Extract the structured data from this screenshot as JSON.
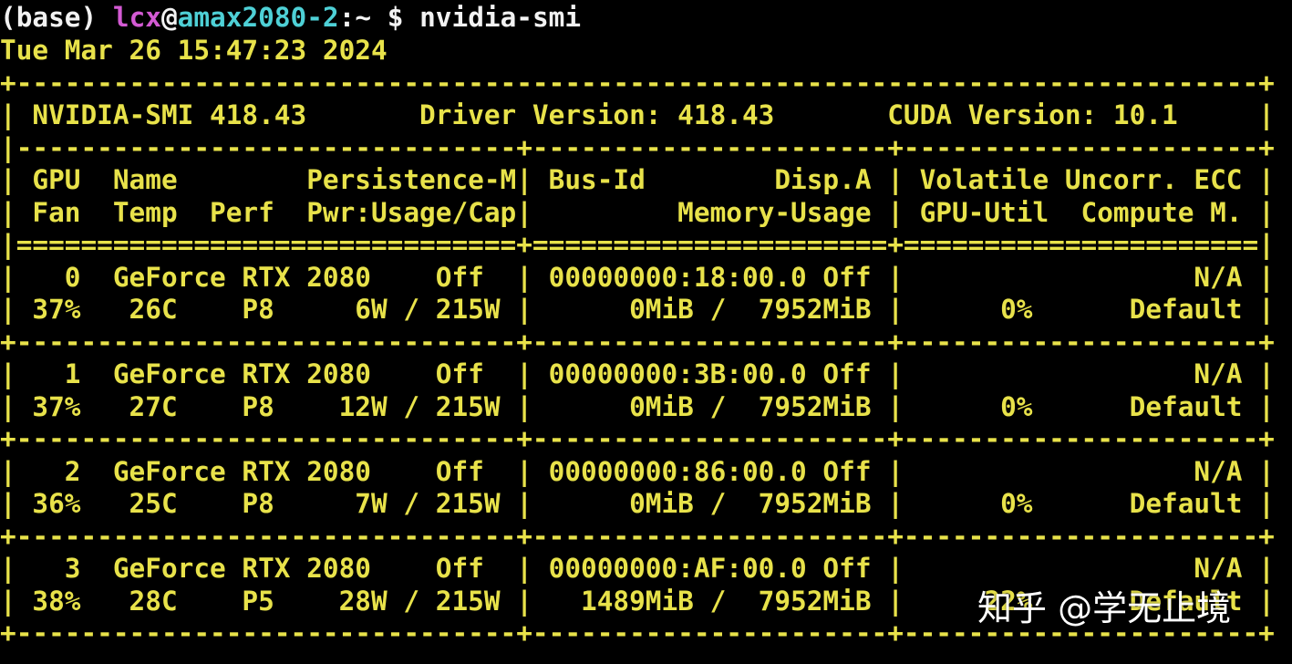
{
  "terminal": {
    "prompt": {
      "env": "(base) ",
      "user": "lcx",
      "at": "@",
      "host": "amax2080-2",
      "path_sep": ":~ $ ",
      "command": "nvidia-smi"
    },
    "timestamp": "Tue Mar 26 15:47:23 2024",
    "lines": [
      "+-----------------------------------------------------------------------------+",
      "| NVIDIA-SMI 418.43       Driver Version: 418.43       CUDA Version: 10.1     |",
      "|-------------------------------+----------------------+----------------------+",
      "| GPU  Name        Persistence-M| Bus-Id        Disp.A | Volatile Uncorr. ECC |",
      "| Fan  Temp  Perf  Pwr:Usage/Cap|         Memory-Usage | GPU-Util  Compute M. |",
      "|===============================+======================+======================|",
      "|   0  GeForce RTX 2080    Off  | 00000000:18:00.0 Off |                  N/A |",
      "| 37%   26C    P8     6W / 215W |      0MiB /  7952MiB |      0%      Default |",
      "+-------------------------------+----------------------+----------------------+",
      "|   1  GeForce RTX 2080    Off  | 00000000:3B:00.0 Off |                  N/A |",
      "| 37%   27C    P8    12W / 215W |      0MiB /  7952MiB |      0%      Default |",
      "+-------------------------------+----------------------+----------------------+",
      "|   2  GeForce RTX 2080    Off  | 00000000:86:00.0 Off |                  N/A |",
      "| 36%   25C    P8     7W / 215W |      0MiB /  7952MiB |      0%      Default |",
      "+-------------------------------+----------------------+----------------------+",
      "|   3  GeForce RTX 2080    Off  | 00000000:AF:00.0 Off |                  N/A |",
      "| 38%   28C    P5    28W / 215W |   1489MiB /  7952MiB |     22%      Default |",
      "+-------------------------------+----------------------+----------------------+"
    ]
  },
  "watermark": {
    "text": "知乎 @学无止境"
  },
  "colors": {
    "background": "#000000",
    "output_text": "#e8e24a",
    "prompt_user": "#d35ad3",
    "prompt_host": "#4ed0d6",
    "prompt_plain": "#f2f2f2"
  }
}
